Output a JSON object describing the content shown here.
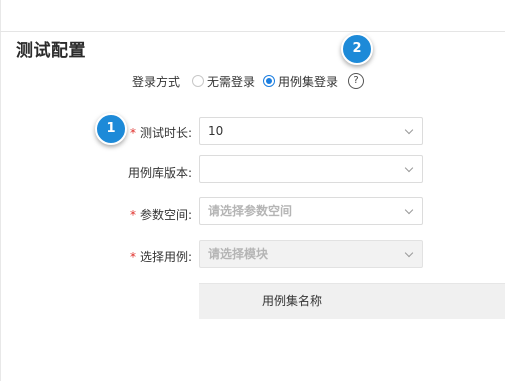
{
  "section": {
    "title": "测试配置"
  },
  "login": {
    "label": "登录方式",
    "options": [
      {
        "label": "无需登录",
        "selected": false
      },
      {
        "label": "用例集登录",
        "selected": true
      }
    ],
    "help_icon": "?"
  },
  "form": {
    "duration": {
      "label": "测试时长:",
      "required": true,
      "value": "10"
    },
    "version": {
      "label": "用例库版本:",
      "required": false,
      "value": ""
    },
    "param_space": {
      "label": "参数空间:",
      "required": true,
      "placeholder": "请选择参数空间"
    },
    "cases": {
      "label": "选择用例:",
      "required": true,
      "placeholder": "请选择模块",
      "disabled": true
    }
  },
  "table": {
    "column_name": "用例集名称"
  },
  "badges": {
    "one": "1",
    "two": "2"
  },
  "colors": {
    "accent": "#1d8ad8",
    "required": "#e0302b",
    "radio_checked": "#1b7ee0"
  }
}
